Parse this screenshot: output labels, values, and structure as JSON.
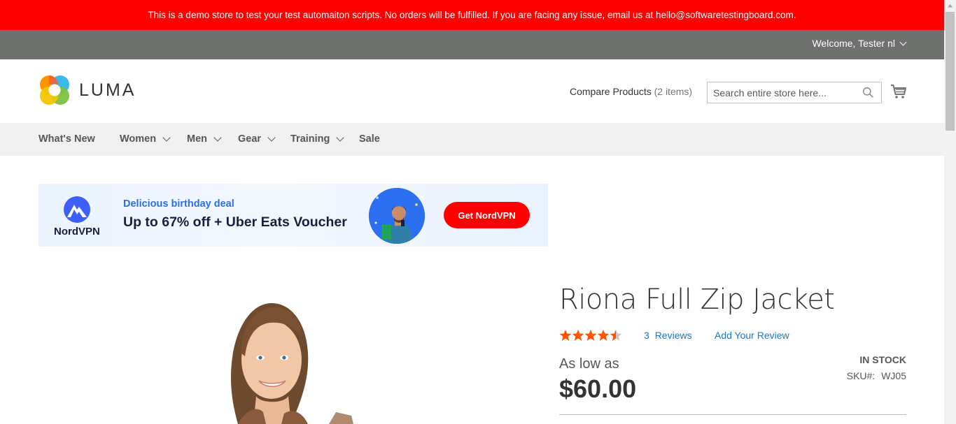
{
  "notice": "This is a demo store to test your test automaiton scripts. No orders will be fulfilled. If you are facing any issue, email us at hello@softwaretestingboard.com.",
  "header": {
    "welcome": "Welcome, Tester nl",
    "logo_text": "LUMA",
    "compare_label": "Compare Products",
    "compare_count": "(2 items)",
    "search_placeholder": "Search entire store here..."
  },
  "nav": {
    "items": [
      {
        "label": "What's New",
        "has_dropdown": false
      },
      {
        "label": "Women",
        "has_dropdown": true
      },
      {
        "label": "Men",
        "has_dropdown": true
      },
      {
        "label": "Gear",
        "has_dropdown": true
      },
      {
        "label": "Training",
        "has_dropdown": true
      },
      {
        "label": "Sale",
        "has_dropdown": false
      }
    ]
  },
  "ad": {
    "brand": "NordVPN",
    "subtitle": "Delicious birthday deal",
    "title": "Up to 67% off + Uber Eats Voucher",
    "cta": "Get NordVPN"
  },
  "product": {
    "name": "Riona Full Zip Jacket",
    "rating_stars": 4.5,
    "reviews_count": "3",
    "reviews_label": "Reviews",
    "add_review": "Add Your Review",
    "price_prefix": "As low as",
    "price": "$60.00",
    "stock": "IN STOCK",
    "sku_label": "SKU#:",
    "sku": "WJ05"
  },
  "colors": {
    "notice_bg": "#ff0000",
    "panel_bg": "#6e716e",
    "nav_bg": "#f0f0f0",
    "link": "#1979c3",
    "star": "#ff5501"
  }
}
